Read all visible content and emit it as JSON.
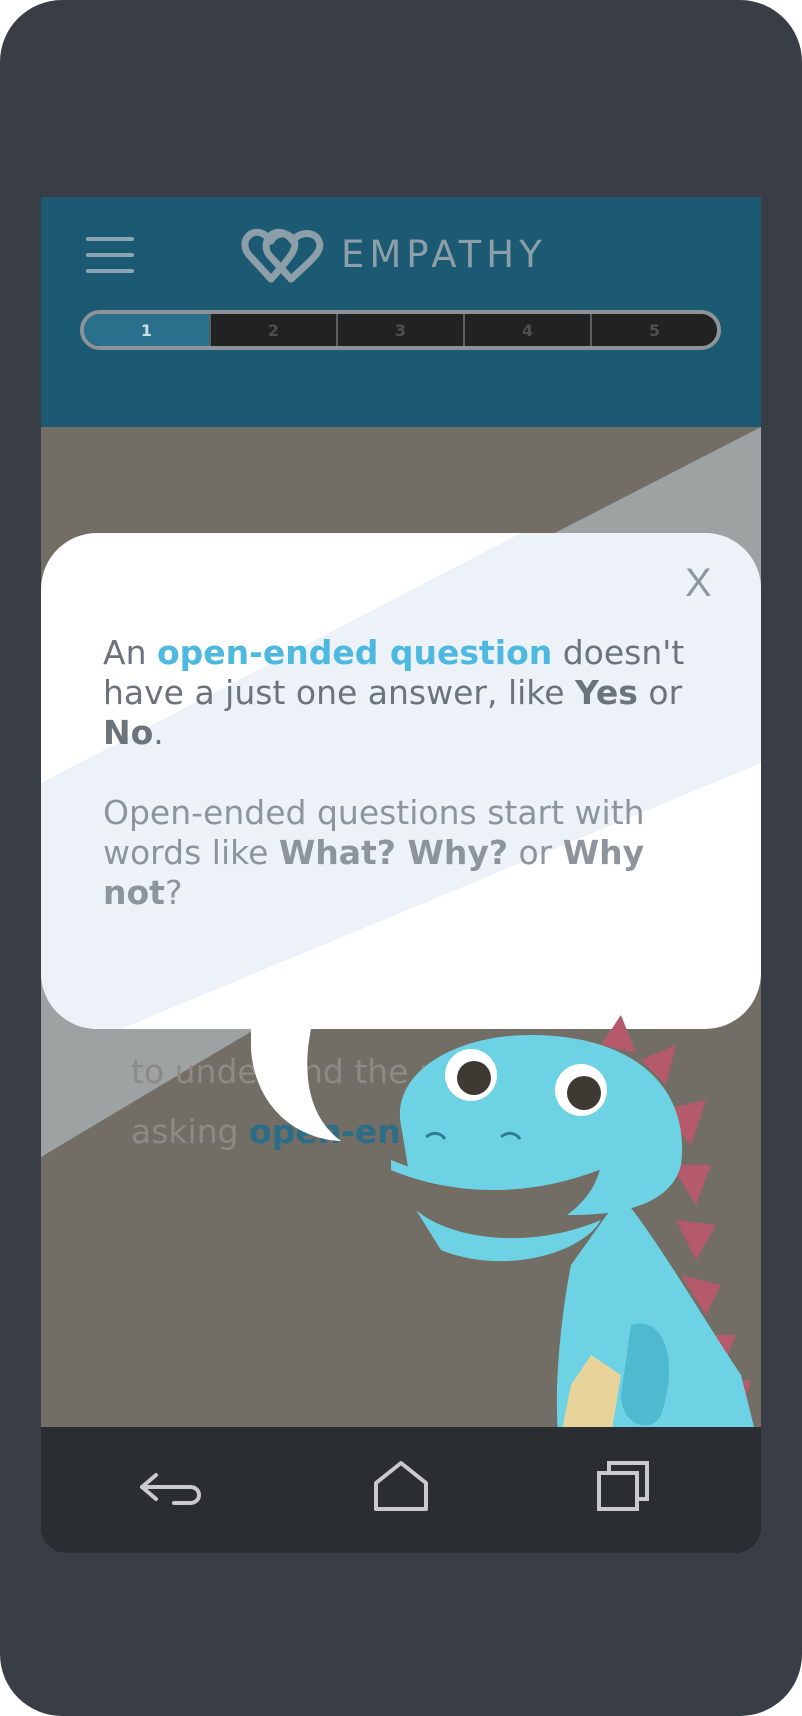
{
  "app": {
    "title": "EMPATHY"
  },
  "progress": {
    "steps": [
      "1",
      "2",
      "3",
      "4",
      "5"
    ],
    "current": 1
  },
  "popup": {
    "close_label": "X",
    "p1": {
      "t1": "An ",
      "kw": "open-ended question",
      "t2": " doesn't have a just one answer, like ",
      "b1": "Yes",
      "t3": " or ",
      "b2": "No",
      "t4": "."
    },
    "p2": {
      "t1": "Open-ended questions start with words like ",
      "b1": "What? Why?",
      "t2": " or ",
      "b2": "Why not",
      "t3": "?"
    }
  },
  "background_text": {
    "line1": "to under   and the us",
    "line2_pre": "asking ",
    "line2_hl": "open-end"
  },
  "nav": {
    "back": "back-icon",
    "home": "home-icon",
    "recents": "recents-icon"
  },
  "colors": {
    "header": "#1c5a73",
    "accent": "#4db8e0",
    "dino": "#6dd3e4",
    "spikes": "#b45a6a"
  }
}
